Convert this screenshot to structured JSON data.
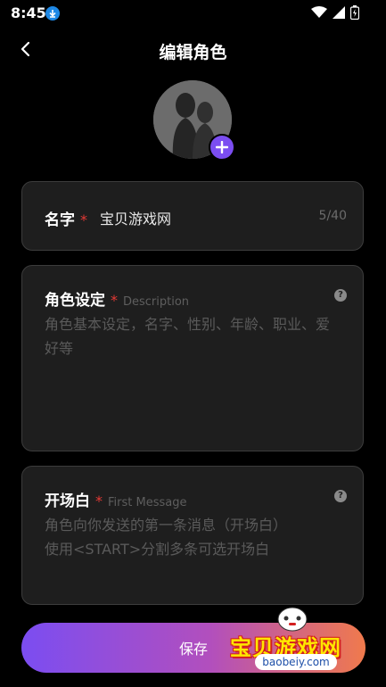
{
  "status_bar": {
    "time": "8:45"
  },
  "header": {
    "title": "编辑角色"
  },
  "fields": {
    "name": {
      "label": "名字",
      "required_mark": "*",
      "value": "宝贝游戏网",
      "counter": "5/40"
    },
    "description": {
      "label": "角色设定",
      "required_mark": "*",
      "sub_label": "Description",
      "placeholder": "角色基本设定，名字、性别、年龄、职业、爱好等",
      "help": "?"
    },
    "first_message": {
      "label": "开场白",
      "required_mark": "*",
      "sub_label": "First Message",
      "placeholder_line1": "角色向你发送的第一条消息（开场白）",
      "placeholder_line2": "使用<START>分割多条可选开场白",
      "help": "?"
    }
  },
  "save_button": {
    "label": "保存"
  },
  "watermark": {
    "text": "宝贝游戏网",
    "url": "baobeiy.com"
  },
  "colors": {
    "accent": "#7b4df1",
    "gradient_end": "#f07a4c",
    "required": "#e53935",
    "card_bg": "#1e1e1e"
  }
}
